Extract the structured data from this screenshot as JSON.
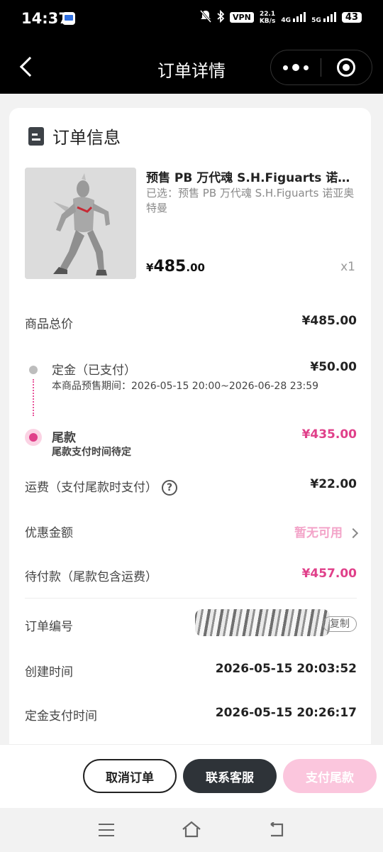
{
  "status_bar": {
    "time": "14:37",
    "vpn": "VPN",
    "speed_value": "22.1",
    "speed_unit": "KB/s",
    "sim1": "4G",
    "sim2": "5G",
    "battery": "43"
  },
  "nav": {
    "title": "订单详情"
  },
  "order_info": {
    "section_title": "订单信息",
    "product": {
      "name": "预售 PB 万代魂 S.H.Figuarts 诺亚奥特曼",
      "spec": "已选：预售 PB 万代魂 S.H.Figuarts 诺亚奥特曼",
      "price_symbol": "¥",
      "price_int": "485",
      "price_dec": ".00",
      "quantity": "x1"
    },
    "total": {
      "label": "商品总价",
      "value": "¥485.00"
    },
    "deposit": {
      "label": "定金（已支付）",
      "value": "¥50.00",
      "period": "本商品预售期间：2026-05-15 20:00~2026-06-28 23:59"
    },
    "balance": {
      "label": "尾款",
      "value": "¥435.00",
      "note": "尾款支付时间待定"
    },
    "shipping": {
      "label": "运费（支付尾款时支付）",
      "help": "?",
      "value": "¥22.00"
    },
    "discount": {
      "label": "优惠金额",
      "value": "暂无可用"
    },
    "pending": {
      "label": "待付款（尾款包含运费）",
      "value": "¥457.00"
    },
    "order_no": {
      "label": "订单编号",
      "copy": "复制"
    },
    "created": {
      "label": "创建时间",
      "value": "2026-05-15 20:03:52"
    },
    "deposit_paid": {
      "label": "定金支付时间",
      "value": "2026-05-15 20:26:17"
    }
  },
  "actions": {
    "cancel": "取消订单",
    "contact": "联系客服",
    "pay_balance": "支付尾款"
  },
  "colors": {
    "accent": "#e0408a",
    "accent_light": "#fbc6dd",
    "dark_button": "#2e3338"
  }
}
